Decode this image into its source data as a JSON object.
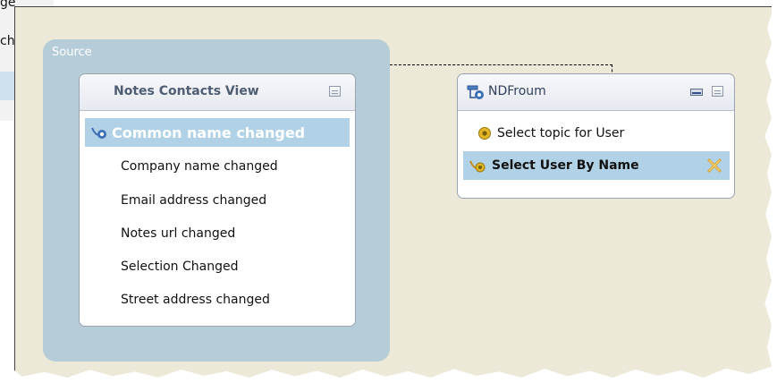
{
  "background": {
    "label_top": "ge",
    "label_mid": "ch"
  },
  "canvas": {
    "source_group": {
      "label": "Source",
      "view": {
        "title": "Notes Contacts View",
        "items": [
          {
            "label": "Common name changed",
            "selected": true,
            "icon": "connector-event-icon"
          },
          {
            "label": "Company name changed"
          },
          {
            "label": "Email address changed"
          },
          {
            "label": "Notes url changed"
          },
          {
            "label": "Selection Changed"
          },
          {
            "label": "Street address changed"
          }
        ]
      }
    },
    "target_view": {
      "title": "NDFroum",
      "items": [
        {
          "label": "Select topic for User",
          "icon": "action-icon"
        },
        {
          "label": "Select User By Name",
          "selected": true,
          "icon": "connector-action-icon"
        }
      ]
    }
  }
}
